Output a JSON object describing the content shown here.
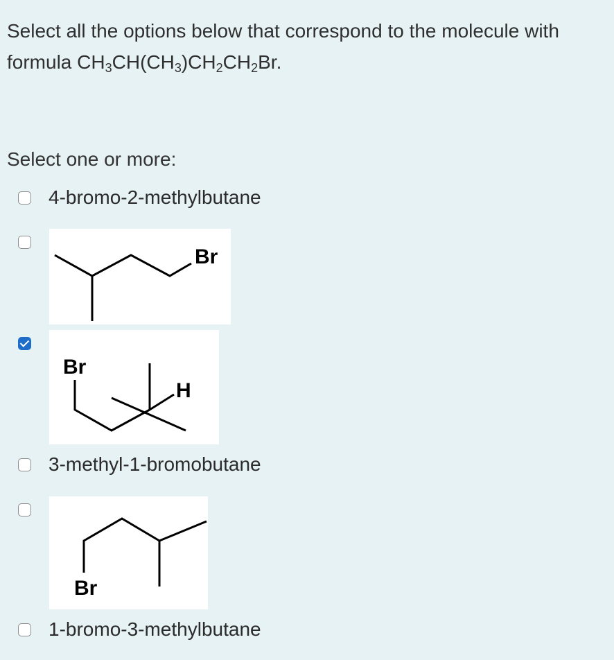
{
  "question": {
    "intro": "Select all the options below that correspond to the molecule with formula ",
    "formula_parts": [
      "CH",
      "3",
      "CH(CH",
      "3",
      ")CH",
      "2",
      "CH",
      "2",
      "Br."
    ]
  },
  "prompt": "Select one or more:",
  "options": [
    {
      "label": "4-bromo-2-methylbutane",
      "checked": false
    },
    {
      "label": "",
      "checked": false,
      "structure_atoms": [
        "Br"
      ]
    },
    {
      "label": "",
      "checked": true,
      "structure_atoms": [
        "Br",
        "H"
      ]
    },
    {
      "label": "3-methyl-1-bromobutane",
      "checked": false
    },
    {
      "label": "",
      "checked": false,
      "structure_atoms": [
        "Br"
      ]
    },
    {
      "label": "1-bromo-3-methylbutane",
      "checked": false
    }
  ],
  "colors": {
    "background": "#e7f2f4",
    "checkbox_checked": "#1e6ec9"
  }
}
